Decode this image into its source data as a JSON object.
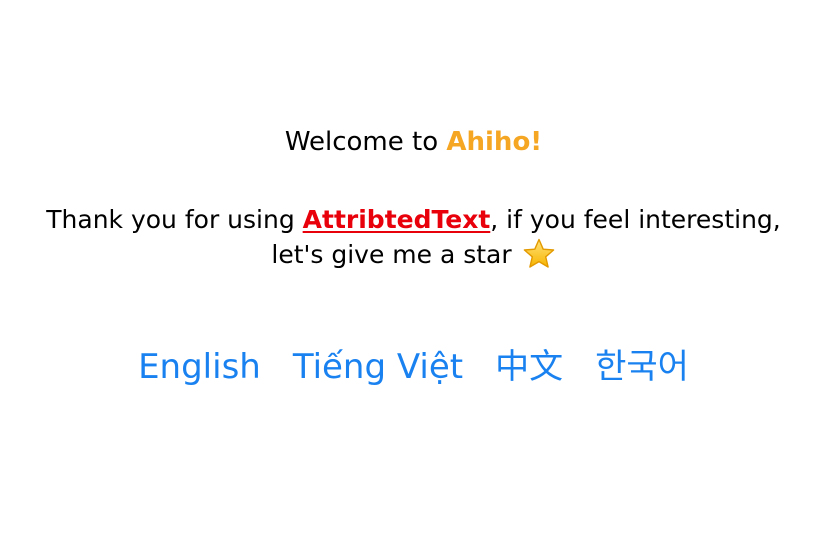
{
  "colors": {
    "text": "#000000",
    "brand": "#F5A623",
    "link_red": "#E8000B",
    "button_blue": "#1A82F0"
  },
  "welcome": {
    "prefix": "Welcome to ",
    "brand": "Ahiho!"
  },
  "message": {
    "before_link": "Thank you for using ",
    "link": "AttribtedText",
    "after_link": ", if you feel interesting,",
    "line2": "let's give me a star ",
    "star_icon": "star-icon"
  },
  "languages": [
    {
      "label": "English"
    },
    {
      "label": "Tiếng Việt"
    },
    {
      "label": "中文"
    },
    {
      "label": "한국어"
    }
  ]
}
